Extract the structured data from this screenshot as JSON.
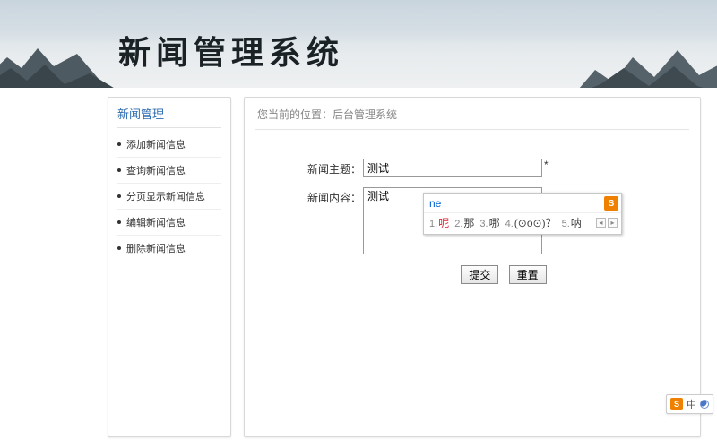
{
  "banner": {
    "title": "新闻管理系统"
  },
  "sidebar": {
    "title": "新闻管理",
    "items": [
      {
        "label": "添加新闻信息"
      },
      {
        "label": "查询新闻信息"
      },
      {
        "label": "分页显示新闻信息"
      },
      {
        "label": "编辑新闻信息"
      },
      {
        "label": "删除新闻信息"
      }
    ]
  },
  "main": {
    "breadcrumb": "您当前的位置：后台管理系统",
    "form": {
      "subject_label": "新闻主题：",
      "subject_value": "测试",
      "required_mark": "*",
      "content_label": "新闻内容：",
      "content_value": "测试",
      "submit_label": "提交",
      "reset_label": "重置"
    }
  },
  "ime": {
    "typed": "ne",
    "logo": "S",
    "candidates": [
      {
        "n": "1.",
        "c": "呢"
      },
      {
        "n": "2.",
        "c": "那"
      },
      {
        "n": "3.",
        "c": "哪"
      },
      {
        "n": "4.",
        "c": "(⊙o⊙)？"
      },
      {
        "n": "5.",
        "c": "呐"
      }
    ]
  },
  "status": {
    "logo": "S",
    "mode": "中"
  }
}
